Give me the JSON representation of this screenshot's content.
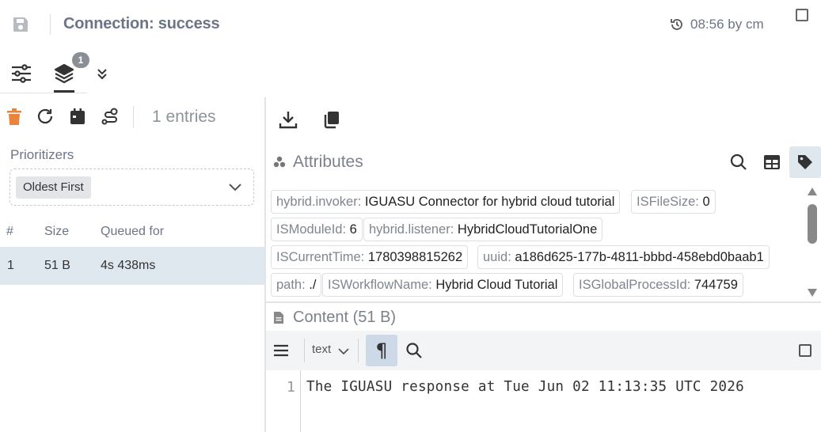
{
  "header": {
    "title": "Connection: success",
    "timestamp": "08:56 by cm",
    "icons": {
      "save": "save-icon",
      "history": "history-icon"
    }
  },
  "tabs": {
    "items": [
      {
        "icon": "sliders-icon",
        "active": false
      },
      {
        "icon": "layers-icon",
        "active": true,
        "badge": "1"
      }
    ],
    "more_icon": "chevron-double-down-icon"
  },
  "queue": {
    "toolbar_icons": [
      "trash-icon",
      "refresh-icon",
      "calendar-icon",
      "route-icon"
    ],
    "entries_count": "1 entries",
    "prioritizers_label": "Prioritizers",
    "prioritizer_selected": "Oldest First",
    "table": {
      "headers": [
        "#",
        "Size",
        "Queued for"
      ],
      "rows": [
        {
          "num": "1",
          "size": "51 B",
          "queued": "4s 438ms"
        }
      ]
    }
  },
  "details": {
    "toolbar_icons": [
      "download-icon",
      "copy-icon"
    ],
    "attributes_title": "Attributes",
    "attributes": [
      {
        "key": "hybrid.invoker:",
        "value": "IGUASU Connector for hybrid cloud tutorial"
      },
      {
        "key": "ISFileSize:",
        "value": "0"
      },
      {
        "key": "ISModuleId:",
        "value": "6"
      },
      {
        "key": "hybrid.listener:",
        "value": "HybridCloudTutorialOne"
      },
      {
        "key": "ISCurrentTime:",
        "value": "1780398815262"
      },
      {
        "key": "uuid:",
        "value": "a186d625-177b-4811-bbbd-458ebd0baab1"
      },
      {
        "key": "path:",
        "value": "./"
      },
      {
        "key": "ISWorkflowName:",
        "value": "Hybrid Cloud Tutorial"
      },
      {
        "key": "ISGlobalProcessId:",
        "value": "744759"
      }
    ],
    "content_title": "Content (51 B)",
    "editor": {
      "mode": "text",
      "lines": [
        {
          "number": "1",
          "text": "The IGUASU response at Tue Jun 02 11:13:35 UTC 2026"
        }
      ]
    }
  },
  "colors": {
    "accent_trash": "#e8843c",
    "selected_row": "#dfe7ef",
    "muted_text": "#6b7587"
  }
}
